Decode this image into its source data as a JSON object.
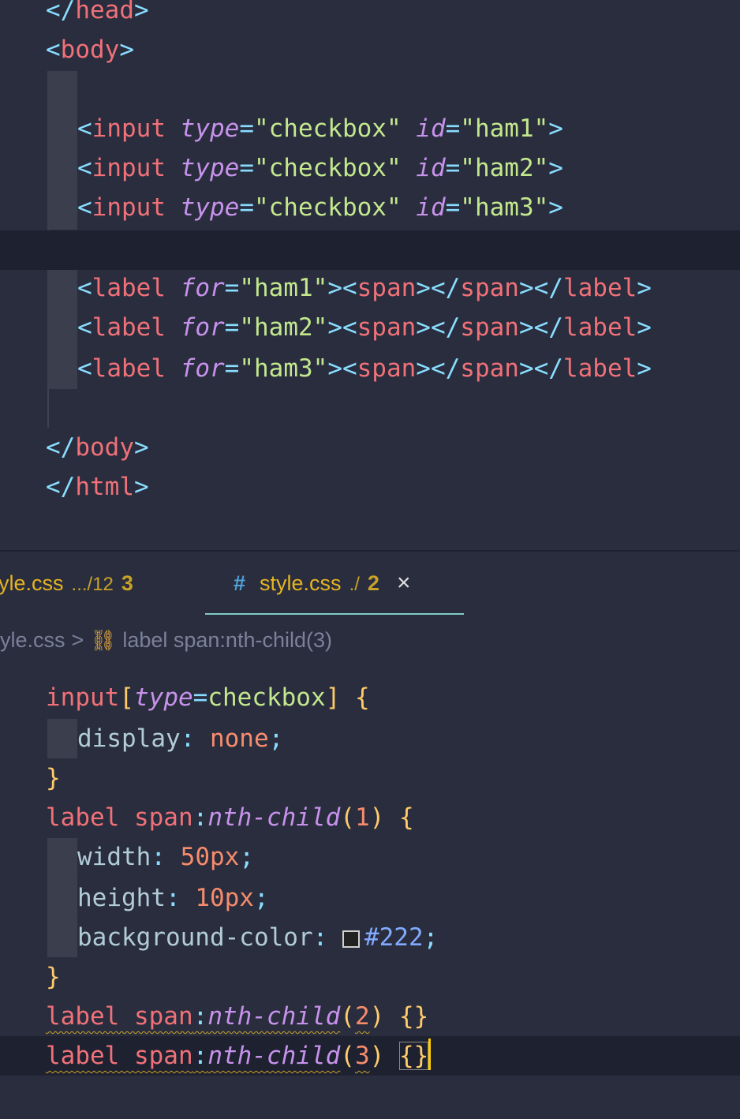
{
  "html_editor": {
    "lines": [
      {
        "tokens": [
          [
            "p",
            "</"
          ],
          [
            "t",
            "head"
          ],
          [
            "p",
            ">"
          ]
        ]
      },
      {
        "tokens": [
          [
            "p",
            "<"
          ],
          [
            "t",
            "body"
          ],
          [
            "p",
            ">"
          ]
        ]
      },
      {
        "tokens": []
      },
      {
        "tokens": [
          [
            "p",
            "<"
          ],
          [
            "t",
            "input "
          ],
          [
            "a",
            "type"
          ],
          [
            "p",
            "="
          ],
          [
            "s",
            "\"checkbox\" "
          ],
          [
            "a",
            "id"
          ],
          [
            "p",
            "="
          ],
          [
            "s",
            "\"ham1\""
          ],
          [
            "p",
            ">"
          ]
        ]
      },
      {
        "tokens": [
          [
            "p",
            "<"
          ],
          [
            "t",
            "input "
          ],
          [
            "a",
            "type"
          ],
          [
            "p",
            "="
          ],
          [
            "s",
            "\"checkbox\" "
          ],
          [
            "a",
            "id"
          ],
          [
            "p",
            "="
          ],
          [
            "s",
            "\"ham2\""
          ],
          [
            "p",
            ">"
          ]
        ]
      },
      {
        "tokens": [
          [
            "p",
            "<"
          ],
          [
            "t",
            "input "
          ],
          [
            "a",
            "type"
          ],
          [
            "p",
            "="
          ],
          [
            "s",
            "\"checkbox\" "
          ],
          [
            "a",
            "id"
          ],
          [
            "p",
            "="
          ],
          [
            "s",
            "\"ham3\""
          ],
          [
            "p",
            ">"
          ]
        ]
      },
      {
        "tokens": []
      },
      {
        "tokens": [
          [
            "p",
            "<"
          ],
          [
            "t",
            "label "
          ],
          [
            "a",
            "for"
          ],
          [
            "p",
            "="
          ],
          [
            "s",
            "\"ham1\""
          ],
          [
            "p",
            "><"
          ],
          [
            "t",
            "span"
          ],
          [
            "p",
            "></"
          ],
          [
            "t",
            "span"
          ],
          [
            "p",
            "></"
          ],
          [
            "t",
            "label"
          ],
          [
            "p",
            ">"
          ]
        ]
      },
      {
        "tokens": [
          [
            "p",
            "<"
          ],
          [
            "t",
            "label "
          ],
          [
            "a",
            "for"
          ],
          [
            "p",
            "="
          ],
          [
            "s",
            "\"ham2\""
          ],
          [
            "p",
            "><"
          ],
          [
            "t",
            "span"
          ],
          [
            "p",
            "></"
          ],
          [
            "t",
            "span"
          ],
          [
            "p",
            "></"
          ],
          [
            "t",
            "label"
          ],
          [
            "p",
            ">"
          ]
        ]
      },
      {
        "tokens": [
          [
            "p",
            "<"
          ],
          [
            "t",
            "label "
          ],
          [
            "a",
            "for"
          ],
          [
            "p",
            "="
          ],
          [
            "s",
            "\"ham3\""
          ],
          [
            "p",
            "><"
          ],
          [
            "t",
            "span"
          ],
          [
            "p",
            "></"
          ],
          [
            "t",
            "span"
          ],
          [
            "p",
            "></"
          ],
          [
            "t",
            "label"
          ],
          [
            "p",
            ">"
          ]
        ]
      },
      {
        "tokens": []
      },
      {
        "tokens": [
          [
            "p",
            "</"
          ],
          [
            "t",
            "body"
          ],
          [
            "p",
            ">"
          ]
        ]
      },
      {
        "tokens": [
          [
            "p",
            "</"
          ],
          [
            "t",
            "html"
          ],
          [
            "p",
            ">"
          ]
        ]
      }
    ]
  },
  "tabs": [
    {
      "name": "yle.css",
      "dir": ".../12",
      "count": "3",
      "active": false
    },
    {
      "icon": "#",
      "name": "style.css",
      "dir": "./",
      "count": "2",
      "close": "×",
      "active": true
    }
  ],
  "breadcrumb": {
    "file": "yle.css",
    "separator": ">",
    "symbol": "label span:nth-child(3)"
  },
  "css_editor": {
    "lines": [
      {
        "tokens": [
          [
            "t",
            "input"
          ],
          [
            "br",
            "["
          ],
          [
            "a",
            "type"
          ],
          [
            "p",
            "="
          ],
          [
            "attrval",
            "checkbox"
          ],
          [
            "br",
            "]"
          ],
          [
            "p",
            " "
          ],
          [
            "br",
            "{"
          ]
        ]
      },
      {
        "tokens": [
          [
            "pr",
            "display"
          ],
          [
            "p",
            ": "
          ],
          [
            "v",
            "none"
          ],
          [
            "p",
            ";"
          ]
        ]
      },
      {
        "tokens": [
          [
            "br",
            "}"
          ]
        ]
      },
      {
        "tokens": [
          [
            "t",
            "label span"
          ],
          [
            "p",
            ":"
          ],
          [
            "ps",
            "nth-child"
          ],
          [
            "br",
            "("
          ],
          [
            "v",
            "1"
          ],
          [
            "br",
            ")"
          ],
          [
            "p",
            " "
          ],
          [
            "br",
            "{"
          ]
        ]
      },
      {
        "tokens": [
          [
            "pr",
            "width"
          ],
          [
            "p",
            ": "
          ],
          [
            "v",
            "50px"
          ],
          [
            "p",
            ";"
          ]
        ]
      },
      {
        "tokens": [
          [
            "pr",
            "height"
          ],
          [
            "p",
            ": "
          ],
          [
            "v",
            "10px"
          ],
          [
            "p",
            ";"
          ]
        ]
      },
      {
        "tokens": [
          [
            "pr",
            "background-color"
          ],
          [
            "p",
            ": "
          ],
          [
            "swatch",
            ""
          ],
          [
            "hx",
            "#222"
          ],
          [
            "p",
            ";"
          ]
        ]
      },
      {
        "tokens": [
          [
            "br",
            "}"
          ]
        ]
      },
      {
        "tokens": [
          [
            "t",
            "label span"
          ],
          [
            "p",
            ":"
          ],
          [
            "ps",
            "nth-child"
          ],
          [
            "br",
            "("
          ],
          [
            "v",
            "2"
          ],
          [
            "br",
            ")"
          ],
          [
            "p",
            " "
          ],
          [
            "br",
            "{}"
          ]
        ]
      },
      {
        "tokens": [
          [
            "t",
            "label span"
          ],
          [
            "p",
            ":"
          ],
          [
            "ps",
            "nth-child"
          ],
          [
            "br",
            "("
          ],
          [
            "v",
            "3"
          ],
          [
            "br",
            ")"
          ],
          [
            "p",
            " "
          ],
          [
            "br",
            "{}"
          ]
        ]
      }
    ]
  }
}
